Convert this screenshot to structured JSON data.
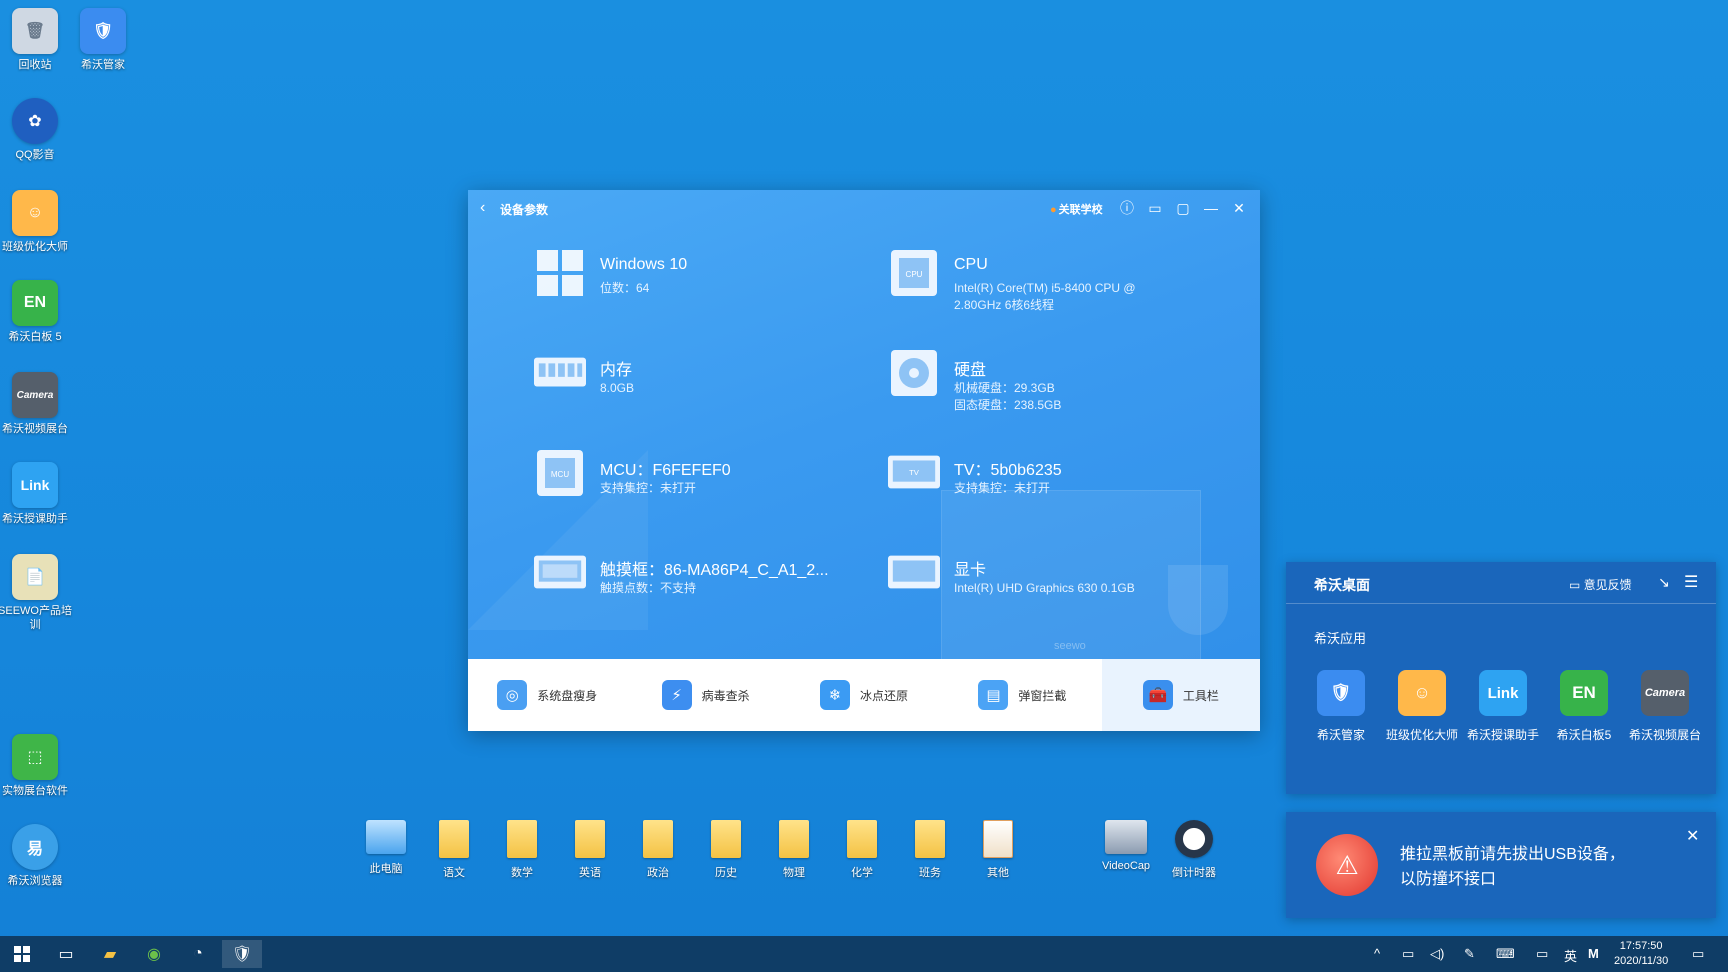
{
  "desktop_icons": [
    {
      "label": "回收站",
      "icon": "recycle-bin-icon",
      "color": "#cfd8e3",
      "glyph": "🗑"
    },
    {
      "label": "希沃管家",
      "icon": "seewo-manager-icon",
      "color": "#3b8cf0",
      "glyph": "🛡"
    },
    {
      "label": "QQ影音",
      "icon": "qq-player-icon",
      "color": "#1f5fc0",
      "glyph": "✿"
    },
    {
      "label": "班级优化大师",
      "icon": "class-optimizer-icon",
      "color": "#ffb84a",
      "glyph": "☺"
    },
    {
      "label": "希沃白板 5",
      "icon": "whiteboard-icon",
      "color": "#37b34a",
      "glyph": "EN"
    },
    {
      "label": "希沃视频展台",
      "icon": "camera-icon",
      "color": "#555f6b",
      "glyph": "Camera"
    },
    {
      "label": "希沃授课助手",
      "icon": "link-icon",
      "color": "#2ea3f2",
      "glyph": "Link"
    },
    {
      "label": "SEEWO产品培训",
      "icon": "document-icon",
      "color": "#e8e1b8",
      "glyph": "📄"
    },
    {
      "label": "实物展台软件",
      "icon": "visualizer-icon",
      "color": "#3fb548",
      "glyph": "⬚"
    },
    {
      "label": "希沃浏览器",
      "icon": "browser-icon",
      "color": "#3aa0e8",
      "glyph": "易"
    }
  ],
  "window": {
    "title": "设备参数",
    "school": "关联学校",
    "specs": [
      {
        "name": "Windows 10",
        "sub1": "位数：64",
        "sub2": "",
        "icon": "windows-icon"
      },
      {
        "name": "CPU",
        "sub1": "Intel(R) Core(TM) i5-8400 CPU @",
        "sub2": "2.80GHz 6核6线程",
        "icon": "cpu-icon"
      },
      {
        "name": "内存",
        "sub1": "8.0GB",
        "sub2": "",
        "icon": "memory-icon"
      },
      {
        "name": "硬盘",
        "sub1": "机械硬盘：29.3GB",
        "sub2": "固态硬盘：238.5GB",
        "icon": "disk-icon"
      },
      {
        "name": "MCU：F6FEFEF0",
        "sub1": "支持集控：未打开",
        "sub2": "",
        "icon": "mcu-icon"
      },
      {
        "name": "TV：5b0b6235",
        "sub1": "支持集控：未打开",
        "sub2": "",
        "icon": "tv-icon"
      },
      {
        "name": "触摸框：86-MA86P4_C_A1_2...",
        "sub1": "触摸点数：不支持",
        "sub2": "",
        "icon": "touch-frame-icon"
      },
      {
        "name": "显卡",
        "sub1": "Intel(R) UHD Graphics 630 0.1GB",
        "sub2": "",
        "icon": "gpu-icon"
      }
    ],
    "watermark": "seewo",
    "tools": [
      {
        "label": "系统盘瘦身",
        "icon": "disk-clean-icon",
        "color": "#4a9ff2"
      },
      {
        "label": "病毒查杀",
        "icon": "virus-scan-icon",
        "color": "#3d8ef0"
      },
      {
        "label": "冰点还原",
        "icon": "freeze-restore-icon",
        "color": "#3b9bf3"
      },
      {
        "label": "弹窗拦截",
        "icon": "popup-block-icon",
        "color": "#4ba3f5"
      },
      {
        "label": "工具栏",
        "icon": "toolbox-icon",
        "color": "#3a8fee"
      }
    ]
  },
  "folders": [
    {
      "label": "此电脑",
      "icon": "computer-icon"
    },
    {
      "label": "语文",
      "icon": "folder-icon"
    },
    {
      "label": "数学",
      "icon": "folder-icon"
    },
    {
      "label": "英语",
      "icon": "folder-icon"
    },
    {
      "label": "政治",
      "icon": "folder-icon"
    },
    {
      "label": "历史",
      "icon": "folder-icon"
    },
    {
      "label": "物理",
      "icon": "folder-icon"
    },
    {
      "label": "化学",
      "icon": "folder-icon"
    },
    {
      "label": "班务",
      "icon": "folder-icon"
    },
    {
      "label": "其他",
      "icon": "folder-icon"
    },
    {
      "label": "VideoCap",
      "icon": "videocap-icon"
    },
    {
      "label": "倒计时器",
      "icon": "timer-icon"
    }
  ],
  "panel": {
    "title": "希沃桌面",
    "feedback": "意见反馈",
    "section": "希沃应用",
    "apps": [
      {
        "label": "希沃管家",
        "glyph": "🛡",
        "color": "#3b8cf0"
      },
      {
        "label": "班级优化大师",
        "glyph": "☺",
        "color": "#ffb84a"
      },
      {
        "label": "希沃授课助手",
        "glyph": "Link",
        "color": "#2ea3f2"
      },
      {
        "label": "希沃白板5",
        "glyph": "EN",
        "color": "#37b34a"
      },
      {
        "label": "希沃视频展台",
        "glyph": "Camera",
        "color": "#555f6b"
      }
    ]
  },
  "notice": {
    "line1": "推拉黑板前请先拔出USB设备，",
    "line2": "以防撞坏接口"
  },
  "taskbar": {
    "ime": "英",
    "ime2": "M",
    "time": "17:57:50",
    "date": "2020/11/30"
  }
}
